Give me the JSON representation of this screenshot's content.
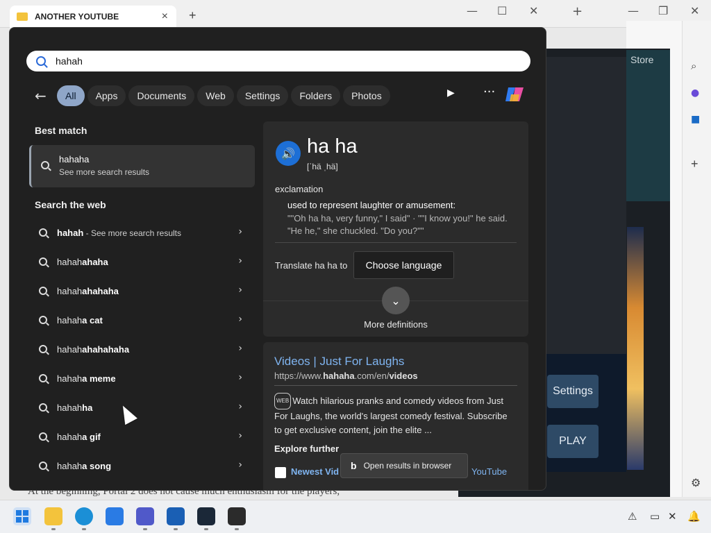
{
  "background": {
    "explorer_tab_title": "ANOTHER YOUTUBE",
    "edge_store_text": "Store",
    "settings_button": "Settings",
    "play_button": "PLAY",
    "page_text": "At the beginning, Portal 2 does not cause much enthusiasm for the players,"
  },
  "search": {
    "query": "hahah",
    "filters": [
      "All",
      "Apps",
      "Documents",
      "Web",
      "Settings",
      "Folders",
      "Photos"
    ],
    "active_filter": "All"
  },
  "best_match": {
    "section_title": "Best match",
    "title": "hahaha",
    "subtitle": "See more search results"
  },
  "search_web": {
    "section_title": "Search the web",
    "first": {
      "bold": "hahah",
      "rest": " - See more search results"
    },
    "items": [
      {
        "prefix": "hahah",
        "bold": "ahaha"
      },
      {
        "prefix": "hahah",
        "bold": "ahahaha"
      },
      {
        "prefix": "hahah",
        "bold": "a cat"
      },
      {
        "prefix": "hahah",
        "bold": "ahahahaha"
      },
      {
        "prefix": "hahah",
        "bold": "a meme"
      },
      {
        "prefix": "hahah",
        "bold": "ha"
      },
      {
        "prefix": "hahah",
        "bold": "a gif"
      },
      {
        "prefix": "hahah",
        "bold": "a song"
      }
    ]
  },
  "dictionary": {
    "word": "ha ha",
    "pronunciation": "[ˈhä ˌhä]",
    "part_of_speech": "exclamation",
    "definition": "used to represent laughter or amusement:",
    "example": "\"\"Oh ha ha, very funny,\" I said\" · \"\"I know you!\" he said. \"He he,\" she chuckled. \"Do you?\"\"",
    "translate_label": "Translate ha ha to",
    "language_button": "Choose language",
    "more_definitions": "More definitions"
  },
  "web_result": {
    "title": "Videos | Just For Laughs",
    "url_prefix": "https://www.",
    "url_bold1": "hahaha",
    "url_mid": ".com/en/",
    "url_bold2": "videos",
    "badge": "WEB",
    "snippet": "Watch hilarious pranks and comedy videos from Just For Laughs, the world's largest comedy festival. Subscribe to get exclusive content, join the elite ...",
    "explore_title": "Explore further",
    "explore_item": "Newest Vid",
    "explore_item_right": "YouTube",
    "open_in_browser": "Open results in browser"
  },
  "colors": {
    "panel_bg": "#202020",
    "card_bg": "#2b2b2b",
    "link_blue": "#7fb4f0",
    "active_pill": "#8fa6c8"
  }
}
